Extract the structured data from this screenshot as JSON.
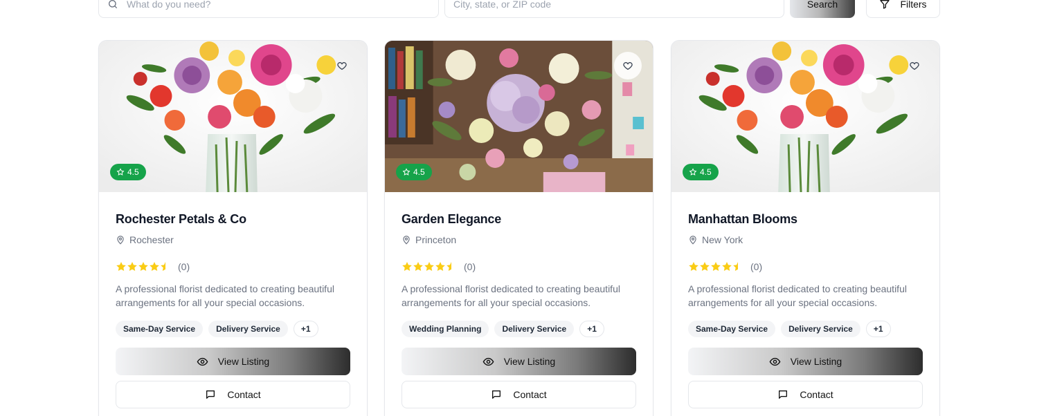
{
  "search": {
    "what_placeholder": "What do you need?",
    "where_placeholder": "City, state, or ZIP code",
    "search_label": "Search",
    "filters_label": "Filters"
  },
  "colors": {
    "rating_badge": "#16a34a",
    "star": "#facc15",
    "border": "#e5e7eb"
  },
  "listings": [
    {
      "name": "Rochester Petals & Co",
      "location": "Rochester",
      "rating_badge": "4.5",
      "stars": 4.5,
      "review_count": "(0)",
      "description": "A professional florist dedicated to creating beautiful arrangements for all your special occasions.",
      "tags": [
        "Same-Day Service",
        "Delivery Service",
        "+1"
      ],
      "view_label": "View Listing",
      "contact_label": "Contact",
      "photo": "vase-bouquet"
    },
    {
      "name": "Garden Elegance",
      "location": "Princeton",
      "rating_badge": "4.5",
      "stars": 4.5,
      "review_count": "(0)",
      "description": "A professional florist dedicated to creating beautiful arrangements for all your special occasions.",
      "tags": [
        "Wedding Planning",
        "Delivery Service",
        "+1"
      ],
      "view_label": "View Listing",
      "contact_label": "Contact",
      "photo": "pastel-arrangement"
    },
    {
      "name": "Manhattan Blooms",
      "location": "New York",
      "rating_badge": "4.5",
      "stars": 4.5,
      "review_count": "(0)",
      "description": "A professional florist dedicated to creating beautiful arrangements for all your special occasions.",
      "tags": [
        "Same-Day Service",
        "Delivery Service",
        "+1"
      ],
      "view_label": "View Listing",
      "contact_label": "Contact",
      "photo": "vase-bouquet"
    }
  ]
}
